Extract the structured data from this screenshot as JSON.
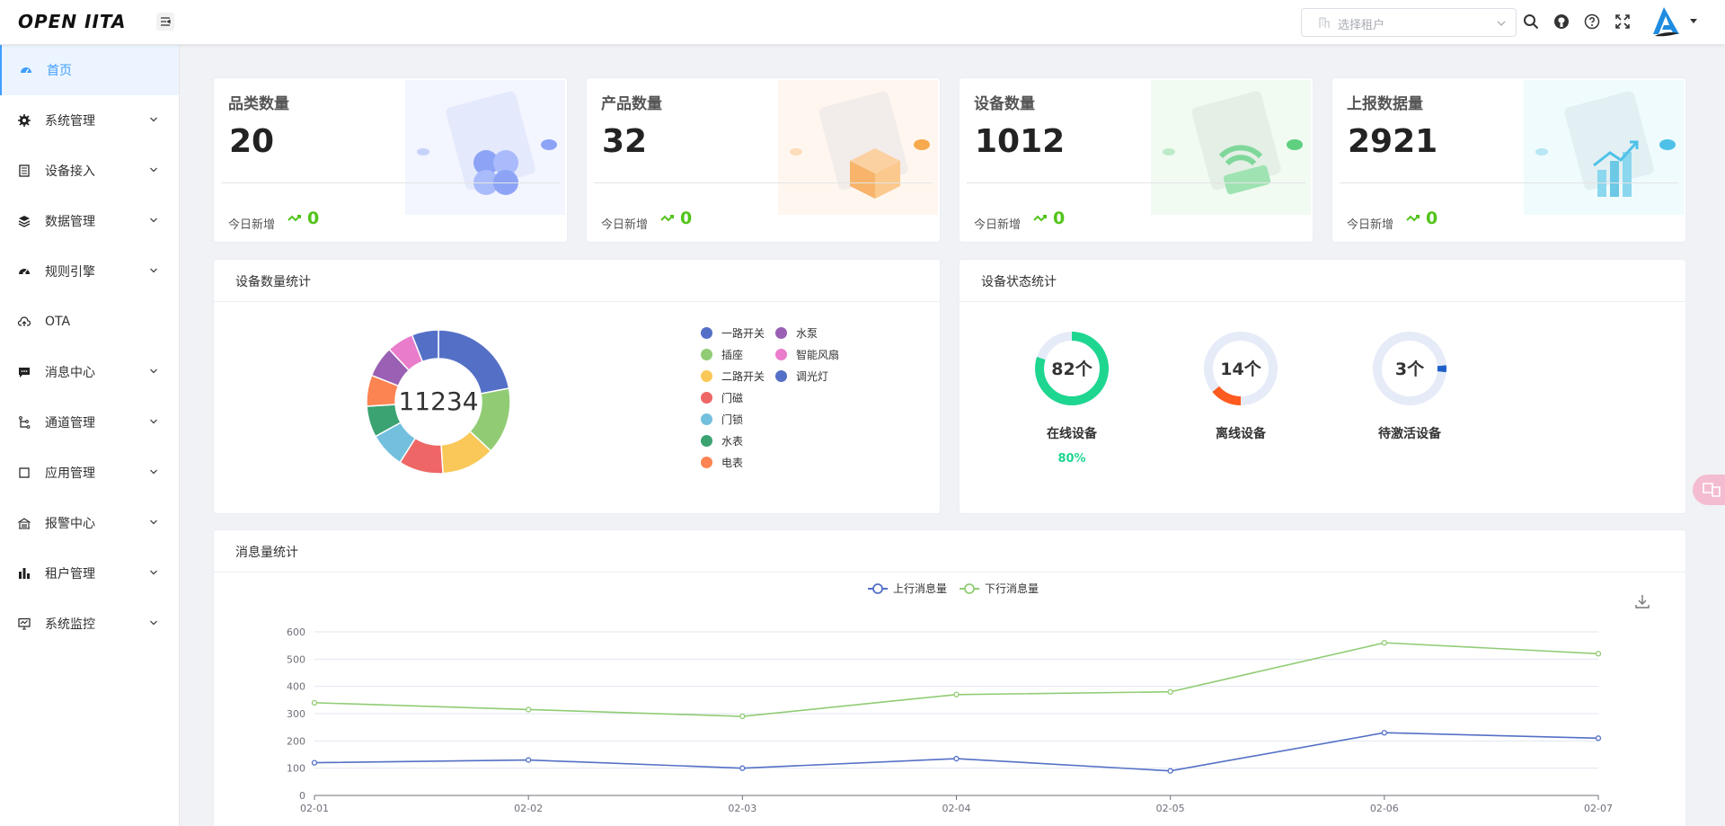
{
  "app": {
    "logo_text": "OPEN IITA"
  },
  "header": {
    "tenant_placeholder": "选择租户",
    "icons": [
      "search-icon",
      "github-icon",
      "help-icon",
      "fullscreen-icon"
    ],
    "colors": {
      "brand": "#409eff"
    }
  },
  "sidebar": {
    "items": [
      {
        "label": "首页",
        "icon": "dashboard-icon",
        "active": true,
        "expandable": false
      },
      {
        "label": "系统管理",
        "icon": "gear-icon",
        "expandable": true
      },
      {
        "label": "设备接入",
        "icon": "device-icon",
        "expandable": true
      },
      {
        "label": "数据管理",
        "icon": "layers-icon",
        "expandable": true
      },
      {
        "label": "规则引擎",
        "icon": "engine-icon",
        "expandable": true
      },
      {
        "label": "OTA",
        "icon": "cloud-upload-icon",
        "expandable": false
      },
      {
        "label": "消息中心",
        "icon": "message-icon",
        "expandable": true
      },
      {
        "label": "通道管理",
        "icon": "channel-icon",
        "expandable": true
      },
      {
        "label": "应用管理",
        "icon": "app-icon",
        "expandable": true
      },
      {
        "label": "报警中心",
        "icon": "alarm-icon",
        "expandable": true
      },
      {
        "label": "租户管理",
        "icon": "bar-chart-icon",
        "expandable": true
      },
      {
        "label": "系统监控",
        "icon": "monitor-icon",
        "expandable": true
      }
    ]
  },
  "stats": [
    {
      "title": "品类数量",
      "value": "20",
      "today_label": "今日新增",
      "today_value": "0",
      "accent": "#6f8df7"
    },
    {
      "title": "产品数量",
      "value": "32",
      "today_label": "今日新增",
      "today_value": "0",
      "accent": "#f7a94e"
    },
    {
      "title": "设备数量",
      "value": "1012",
      "today_label": "今日新增",
      "today_value": "0",
      "accent": "#5fcf80"
    },
    {
      "title": "上报数据量",
      "value": "2921",
      "today_label": "今日新增",
      "today_value": "0",
      "accent": "#4fc1e9"
    }
  ],
  "device_count_panel": {
    "title": "设备数量统计",
    "center_label": "11234",
    "chart_data": {
      "type": "pie",
      "categories": [
        "一路开关",
        "插座",
        "二路开关",
        "门磁",
        "门锁",
        "水表",
        "电表",
        "水泵",
        "智能风扇",
        "调光灯"
      ],
      "values": [
        22,
        15,
        12,
        10,
        8,
        7,
        7,
        7,
        6,
        6
      ],
      "colors": [
        "#5470c6",
        "#91cc75",
        "#fac858",
        "#ee6666",
        "#73c0de",
        "#3ba272",
        "#fc8452",
        "#9a60b4",
        "#ea7ccc",
        "#5470c6"
      ]
    }
  },
  "device_status_panel": {
    "title": "设备状态统计",
    "items": [
      {
        "value_label": "82个",
        "label": "在线设备",
        "percent_label": "80%",
        "fraction": 0.8,
        "color": "#1ed690"
      },
      {
        "value_label": "14个",
        "label": "离线设备",
        "percent_label": "",
        "fraction": 0.14,
        "color": "#ff5a1f"
      },
      {
        "value_label": "3个",
        "label": "待激活设备",
        "percent_label": "",
        "fraction": 0.03,
        "color": "#1f5fc8"
      }
    ]
  },
  "message_panel": {
    "title": "消息量统计",
    "chart_data": {
      "type": "line",
      "x": [
        "02-01",
        "02-02",
        "02-03",
        "02-04",
        "02-05",
        "02-06",
        "02-07"
      ],
      "ylim": [
        0,
        600
      ],
      "yticks": [
        0,
        100,
        200,
        300,
        400,
        500,
        600
      ],
      "grid": true,
      "legend": "top-center",
      "series": [
        {
          "name": "上行消息量",
          "color": "#5470c6",
          "values": [
            120,
            130,
            100,
            135,
            90,
            230,
            210
          ]
        },
        {
          "name": "下行消息量",
          "color": "#91cc75",
          "values": [
            340,
            315,
            290,
            370,
            380,
            560,
            520
          ]
        }
      ]
    }
  }
}
